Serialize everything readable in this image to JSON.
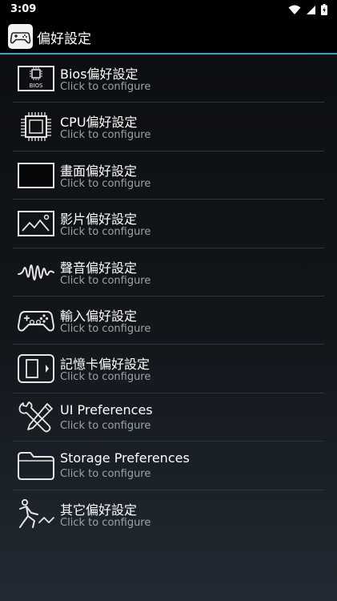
{
  "status": {
    "time": "3:09"
  },
  "app": {
    "title": "偏好設定"
  },
  "items": [
    {
      "title": "Bios偏好設定",
      "summary": "Click to configure",
      "icon": "bios-chip-icon",
      "icon_text": "BIOS"
    },
    {
      "title": "CPU偏好設定",
      "summary": "Click to configure",
      "icon": "cpu-icon"
    },
    {
      "title": "畫面偏好設定",
      "summary": "Click to configure",
      "icon": "display-icon"
    },
    {
      "title": "影片偏好設定",
      "summary": "Click to configure",
      "icon": "picture-icon"
    },
    {
      "title": "聲音偏好設定",
      "summary": "Click to configure",
      "icon": "sound-wave-icon"
    },
    {
      "title": "輸入偏好設定",
      "summary": "Click to configure",
      "icon": "gamepad-icon"
    },
    {
      "title": "記憶卡偏好設定",
      "summary": "Click to configure",
      "icon": "memory-card-icon"
    },
    {
      "title": "UI Preferences",
      "summary": "Click to configure",
      "icon": "tools-icon"
    },
    {
      "title": "Storage Preferences",
      "summary": "Click to configure",
      "icon": "folder-icon"
    },
    {
      "title": "其它偏好設定",
      "summary": "Click to configure",
      "icon": "running-figure-icon"
    }
  ]
}
